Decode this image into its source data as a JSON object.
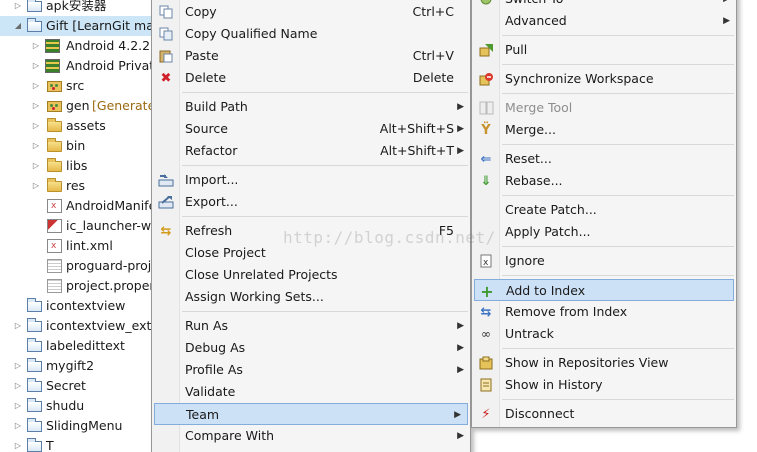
{
  "tree": {
    "rows": [
      {
        "label": "apk安装器",
        "decoration": ""
      },
      {
        "label": "Gift [LearnGit mas",
        "decoration": ""
      },
      {
        "label": "Android 4.2.2",
        "decoration": ""
      },
      {
        "label": "Android Private",
        "decoration": ""
      },
      {
        "label": "src",
        "decoration": ""
      },
      {
        "label": "gen",
        "decoration": "[Generated"
      },
      {
        "label": "assets",
        "decoration": ""
      },
      {
        "label": "bin",
        "decoration": ""
      },
      {
        "label": "libs",
        "decoration": ""
      },
      {
        "label": "res",
        "decoration": ""
      },
      {
        "label": "AndroidManife",
        "decoration": ""
      },
      {
        "label": "ic_launcher-we",
        "decoration": ""
      },
      {
        "label": "lint.xml",
        "decoration": ""
      },
      {
        "label": "proguard-proj",
        "decoration": ""
      },
      {
        "label": "project.proper",
        "decoration": ""
      },
      {
        "label": "icontextview",
        "decoration": ""
      },
      {
        "label": "icontextview_ext",
        "decoration": ""
      },
      {
        "label": "labeledittext",
        "decoration": ""
      },
      {
        "label": "mygift2",
        "decoration": ""
      },
      {
        "label": "Secret",
        "decoration": ""
      },
      {
        "label": "shudu",
        "decoration": ""
      },
      {
        "label": "SlidingMenu",
        "decoration": ""
      },
      {
        "label": "T",
        "decoration": ""
      }
    ]
  },
  "context_menu": {
    "items": [
      {
        "label": "Copy",
        "accel": "Ctrl+C",
        "icon": "copy-icon"
      },
      {
        "label": "Copy Qualified Name",
        "accel": "",
        "icon": "copy-qualified-icon"
      },
      {
        "label": "Paste",
        "accel": "Ctrl+V",
        "icon": "paste-icon"
      },
      {
        "label": "Delete",
        "accel": "Delete",
        "icon": "delete-icon"
      },
      {
        "label": "Build Path",
        "accel": "",
        "icon": ""
      },
      {
        "label": "Source",
        "accel": "Alt+Shift+S",
        "icon": ""
      },
      {
        "label": "Refactor",
        "accel": "Alt+Shift+T",
        "icon": ""
      },
      {
        "label": "Import...",
        "accel": "",
        "icon": "import-icon"
      },
      {
        "label": "Export...",
        "accel": "",
        "icon": "export-icon"
      },
      {
        "label": "Refresh",
        "accel": "F5",
        "icon": "refresh-icon"
      },
      {
        "label": "Close Project",
        "accel": "",
        "icon": ""
      },
      {
        "label": "Close Unrelated Projects",
        "accel": "",
        "icon": ""
      },
      {
        "label": "Assign Working Sets...",
        "accel": "",
        "icon": ""
      },
      {
        "label": "Run As",
        "accel": "",
        "icon": ""
      },
      {
        "label": "Debug As",
        "accel": "",
        "icon": ""
      },
      {
        "label": "Profile As",
        "accel": "",
        "icon": ""
      },
      {
        "label": "Validate",
        "accel": "",
        "icon": ""
      },
      {
        "label": "Team",
        "accel": "",
        "icon": ""
      },
      {
        "label": "Compare With",
        "accel": "",
        "icon": ""
      }
    ]
  },
  "team_menu": {
    "items": [
      {
        "label": "Switch To",
        "icon": "switch-icon"
      },
      {
        "label": "Advanced",
        "icon": ""
      },
      {
        "label": "Pull",
        "icon": "pull-icon"
      },
      {
        "label": "Synchronize Workspace",
        "icon": "synchronize-icon"
      },
      {
        "label": "Merge Tool",
        "icon": "merge-tool-icon"
      },
      {
        "label": "Merge...",
        "icon": "merge-icon"
      },
      {
        "label": "Reset...",
        "icon": "reset-icon"
      },
      {
        "label": "Rebase...",
        "icon": "rebase-icon"
      },
      {
        "label": "Create Patch...",
        "icon": ""
      },
      {
        "label": "Apply Patch...",
        "icon": ""
      },
      {
        "label": "Ignore",
        "icon": "ignore-icon"
      },
      {
        "label": "Add to Index",
        "icon": "add-icon"
      },
      {
        "label": "Remove from Index",
        "icon": "remove-icon"
      },
      {
        "label": "Untrack",
        "icon": "untrack-icon"
      },
      {
        "label": "Show in Repositories View",
        "icon": "repositories-icon"
      },
      {
        "label": "Show in History",
        "icon": "history-icon"
      },
      {
        "label": "Disconnect",
        "icon": "disconnect-icon"
      }
    ]
  },
  "watermark": "http://blog.csdn.net/",
  "colors": {
    "selection": "#cde6f7",
    "menu_highlight": "#cde1f6",
    "menu_highlight_border": "#84acdd",
    "menu_background": "#f5f5f5",
    "disabled_text": "#8e8e8e"
  }
}
